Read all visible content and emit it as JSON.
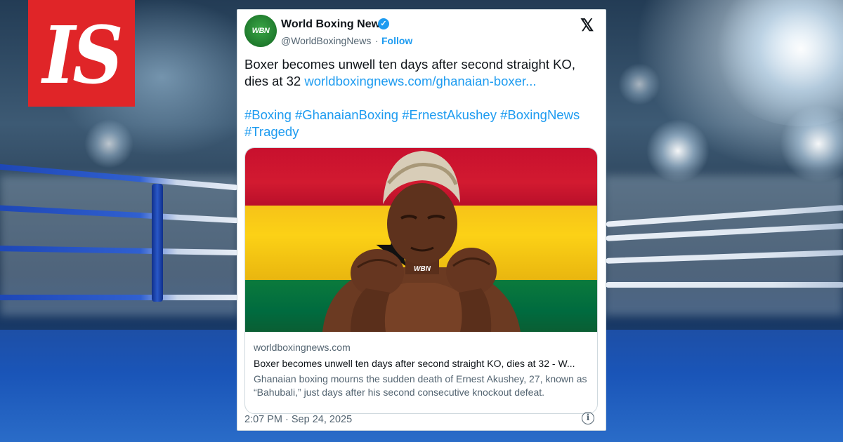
{
  "publisher": {
    "logo_text": "IS",
    "logo_color": "#e02528"
  },
  "tweet": {
    "account_name": "World Boxing News",
    "avatar_text": "WBN",
    "handle": "@WorldBoxingNews",
    "separator": "·",
    "follow_label": "Follow",
    "platform_icon": "x-logo-icon",
    "text": "Boxer becomes unwell ten days after second straight KO, dies at 32",
    "link_text": "worldboxingnews.com/ghanaian-boxer...",
    "hashtags": [
      "#Boxing",
      "#GhanaianBoxing",
      "#ErnestAkushey",
      "#BoxingNews",
      "#Tragedy"
    ],
    "link_card": {
      "domain": "worldboxingnews.com",
      "title": "Boxer becomes unwell ten days after second straight KO, dies at 32 - W...",
      "description": "Ghanaian boxing mourns the sudden death of Ernest Akushey, 27, known as “Bahubali,” just days after his second consecutive knockout defeat.",
      "image_watermark": "WBN"
    },
    "timestamp": "2:07 PM · Sep 24, 2025",
    "info_icon": "info-icon"
  },
  "colors": {
    "link": "#1d9bf0",
    "verified": "#1d9bf0",
    "text": "#0f1419",
    "muted": "#536471"
  }
}
